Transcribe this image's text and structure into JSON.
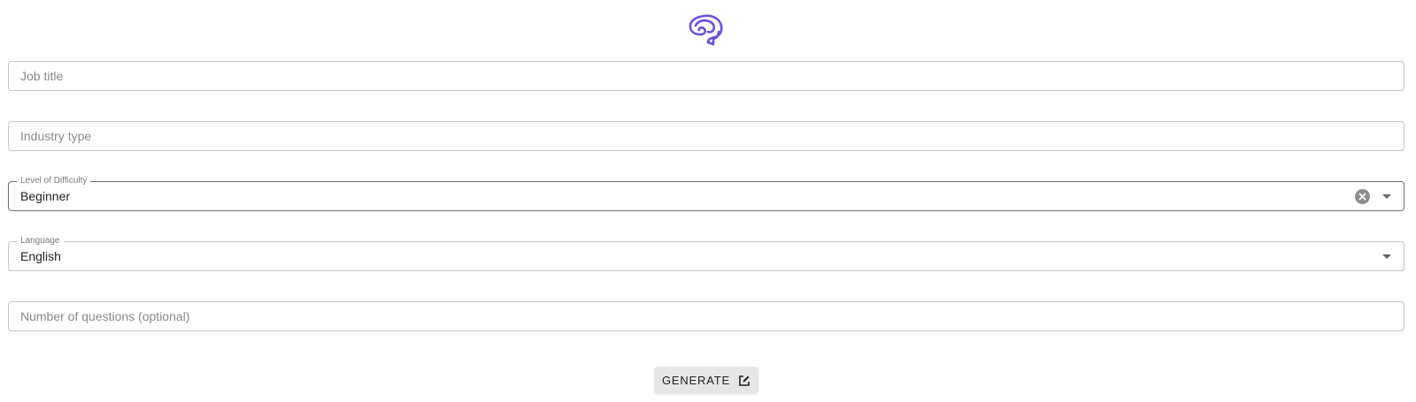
{
  "logo": {
    "icon": "brain-speech-bubble-icon",
    "color": "#6b4fd8"
  },
  "form": {
    "job_title": {
      "placeholder": "Job title",
      "value": ""
    },
    "industry_type": {
      "placeholder": "Industry type",
      "value": ""
    },
    "difficulty": {
      "label": "Level of Difficulty",
      "value": "Beginner"
    },
    "language": {
      "label": "Language",
      "value": "English"
    },
    "num_questions": {
      "placeholder": "Number of questions (optional)",
      "value": ""
    }
  },
  "generate_button": {
    "label": "GENERATE",
    "icon": "edit-icon"
  }
}
